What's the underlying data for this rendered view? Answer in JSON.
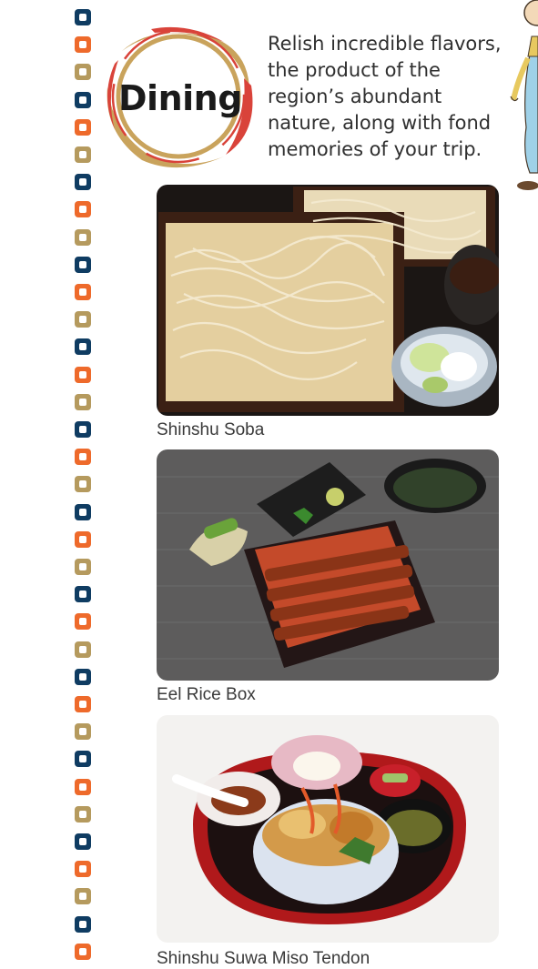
{
  "header": {
    "emblem_label": "Dining",
    "intro_lines": [
      "Relish incredible flavors,",
      "the product of the",
      "region’s abundant",
      "nature, along with fond",
      "memories of your trip."
    ]
  },
  "dishes": [
    {
      "caption": "Shinshu Soba",
      "photo_icon": "soba-noodles-photo"
    },
    {
      "caption": "Eel Rice Box",
      "photo_icon": "eel-rice-box-photo"
    },
    {
      "caption": "Shinshu Suwa Miso Tendon",
      "photo_icon": "miso-tendon-photo"
    }
  ],
  "palette": {
    "navy": "#0f3c62",
    "orange": "#ee6a2b",
    "tan": "#b59a5e",
    "emblem_red": "#d9433a",
    "emblem_gold": "#c9a35c"
  },
  "dot_pattern": [
    "navy",
    "orange",
    "tan"
  ]
}
